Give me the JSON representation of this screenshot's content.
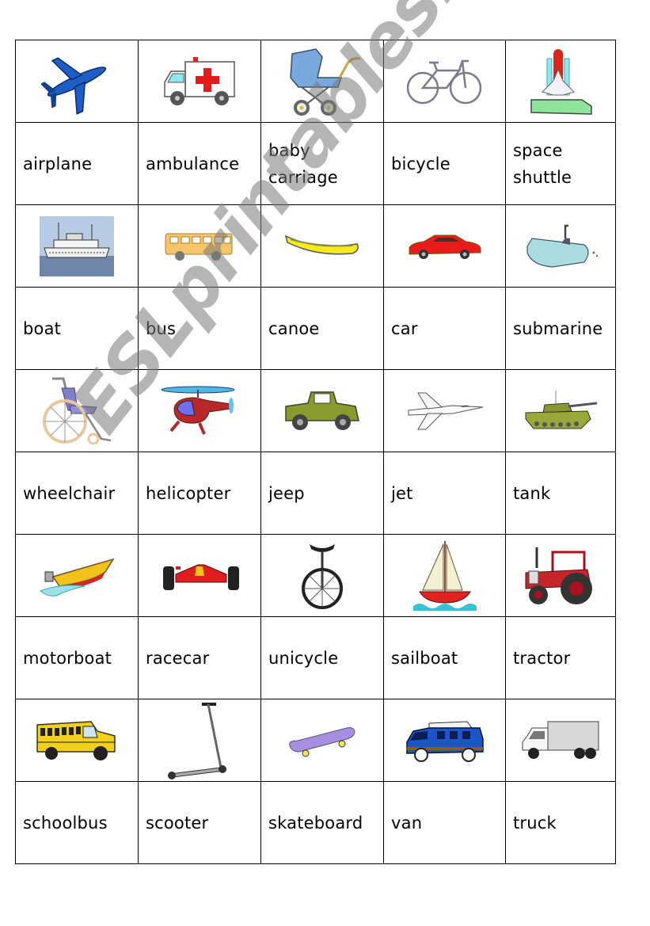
{
  "worksheet": {
    "watermark": "ESLprintables.com",
    "rows": [
      {
        "pictures": [
          "airplane-icon",
          "ambulance-icon",
          "baby-carriage-icon",
          "bicycle-icon",
          "space-shuttle-icon"
        ],
        "words": [
          "airplane",
          "ambulance",
          "baby\ncarriage",
          "bicycle",
          "space\nshuttle"
        ]
      },
      {
        "pictures": [
          "boat-icon",
          "bus-icon",
          "canoe-icon",
          "car-icon",
          "submarine-icon"
        ],
        "words": [
          "boat",
          "bus",
          "canoe",
          "car",
          "submarine"
        ]
      },
      {
        "pictures": [
          "wheelchair-icon",
          "helicopter-icon",
          "jeep-icon",
          "jet-icon",
          "tank-icon"
        ],
        "words": [
          "wheelchair",
          "helicopter",
          "jeep",
          "jet",
          "tank"
        ]
      },
      {
        "pictures": [
          "motorboat-icon",
          "racecar-icon",
          "unicycle-icon",
          "sailboat-icon",
          "tractor-icon"
        ],
        "words": [
          "motorboat",
          "racecar",
          "unicycle",
          "sailboat",
          "tractor"
        ]
      },
      {
        "pictures": [
          "schoolbus-icon",
          "scooter-icon",
          "skateboard-icon",
          "van-icon",
          "truck-icon"
        ],
        "words": [
          "schoolbus",
          "scooter",
          "skateboard",
          "van",
          "truck"
        ]
      }
    ]
  }
}
